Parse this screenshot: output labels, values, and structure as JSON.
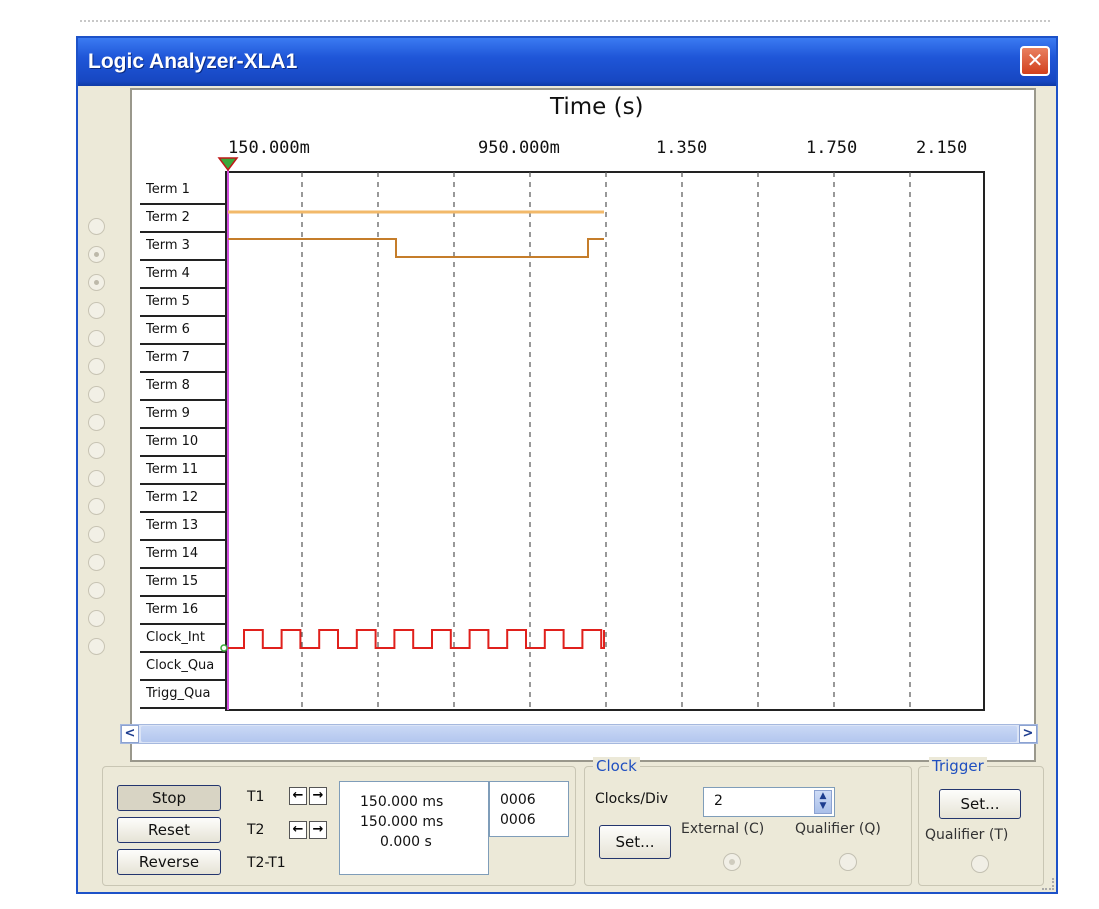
{
  "window": {
    "title": "Logic Analyzer-XLA1",
    "close_glyph": "✕"
  },
  "plot": {
    "axis_title": "Time (s)",
    "x_ticks": [
      "150.000m",
      "950.000m",
      "1.350",
      "1.750",
      "2.150"
    ],
    "terms": [
      "Term 1",
      "Term 2",
      "Term 3",
      "Term 4",
      "Term 5",
      "Term 6",
      "Term 7",
      "Term 8",
      "Term 9",
      "Term 10",
      "Term 11",
      "Term 12",
      "Term 13",
      "Term 14",
      "Term 15",
      "Term 16"
    ],
    "extra_rows": [
      "Clock_Int",
      "Clock_Qua",
      "Trigg_Qua"
    ],
    "colors": {
      "term2": "#f2b96a",
      "term3": "#c57d2a",
      "clock": "#e0201c",
      "cursor": "#d14fe0",
      "cursor_marker": "#3aa83a"
    },
    "selected_pins": [
      2,
      3
    ]
  },
  "scroll": {
    "left_glyph": "<",
    "right_glyph": ">"
  },
  "controls": {
    "stop_label": "Stop",
    "reset_label": "Reset",
    "reverse_label": "Reverse",
    "t1_label": "T1",
    "t2_label": "T2",
    "t2t1_label": "T2-T1",
    "t1_value": "150.000 ms",
    "t2_value": "150.000 ms",
    "diff_value": "0.000 s",
    "t1_code": "0006",
    "t2_code": "0006",
    "left_arrow": "←",
    "right_arrow": "→"
  },
  "clock": {
    "group_title": "Clock",
    "clocks_div_label": "Clocks/Div",
    "clocks_div_value": "2",
    "set_label": "Set...",
    "external_label": "External (C)",
    "qualifier_label": "Qualifier (Q)"
  },
  "trigger": {
    "group_title": "Trigger",
    "set_label": "Set...",
    "qualifier_label": "Qualifier (T)"
  }
}
